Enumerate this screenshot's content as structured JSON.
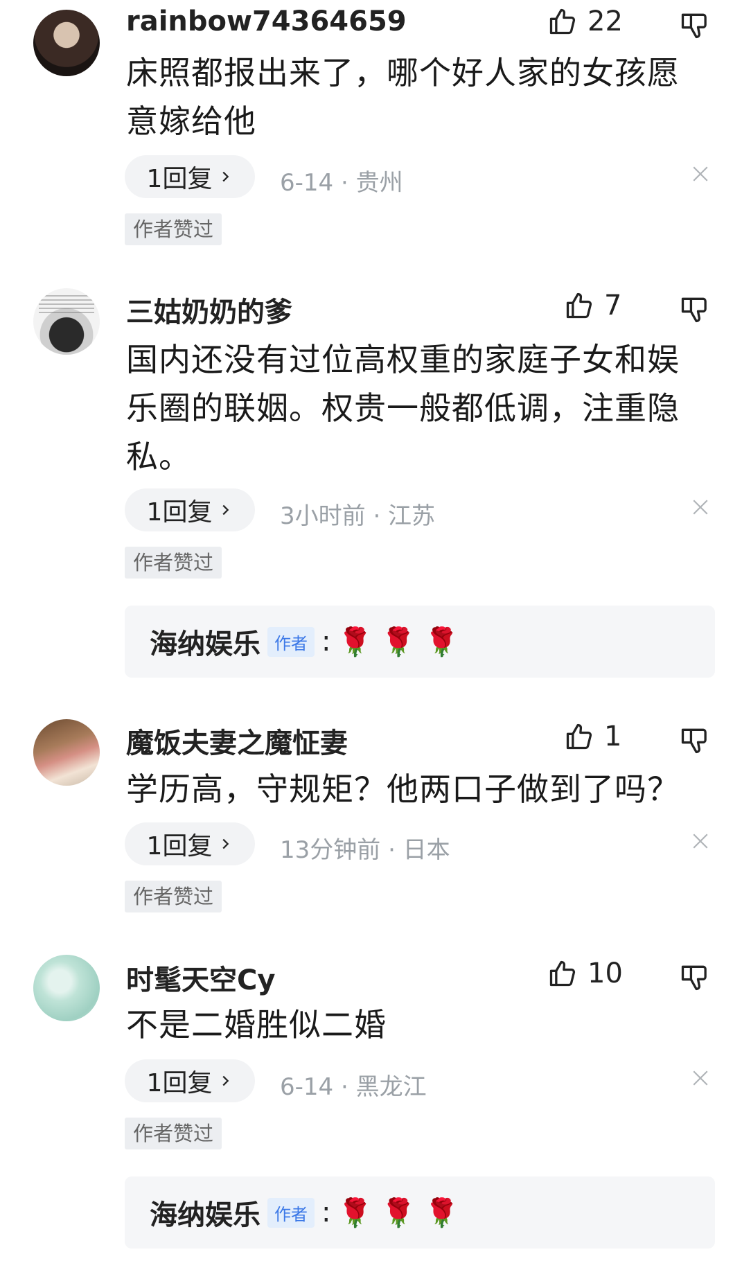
{
  "comments": [
    {
      "username": "rainbow74364659",
      "likes": "22",
      "text": "床照都报出来了，哪个好人家的女孩愿意嫁给他",
      "reply_label": "1回复",
      "meta": "6-14 · 贵州",
      "author_tag": "作者赞过"
    },
    {
      "username": "三姑奶奶的爹",
      "likes": "7",
      "text": "国内还没有过位高权重的家庭子女和娱乐圈的联姻。权贵一般都低调，注重隐私。",
      "reply_label": "1回复",
      "meta": "3小时前 · 江苏",
      "author_tag": "作者赞过",
      "author_reply": {
        "name": "海纳娱乐",
        "badge": "作者",
        "colon": ":",
        "content": "🌹 🌹 🌹"
      }
    },
    {
      "username": "魔饭夫妻之魔怔妻",
      "likes": "1",
      "text": "学历高，守规矩？他两口子做到了吗？",
      "reply_label": "1回复",
      "meta": "13分钟前 · 日本",
      "author_tag": "作者赞过"
    },
    {
      "username": "时髦天空Cy",
      "likes": "10",
      "text": "不是二婚胜似二婚",
      "reply_label": "1回复",
      "meta": "6-14 · 黑龙江",
      "author_tag": "作者赞过",
      "author_reply": {
        "name": "海纳娱乐",
        "badge": "作者",
        "colon": ":",
        "content": "🌹 🌹 🌹"
      }
    }
  ],
  "icons": {
    "like": "thumbs-up-icon",
    "dislike": "thumbs-down-icon",
    "reply_chevron": "chevron-right-icon",
    "close": "close-icon"
  },
  "colors": {
    "meta_text": "#9aa0a6",
    "pill_bg": "#f2f3f5",
    "author_badge": "#3b78e7",
    "rose": "#d71c2a"
  }
}
